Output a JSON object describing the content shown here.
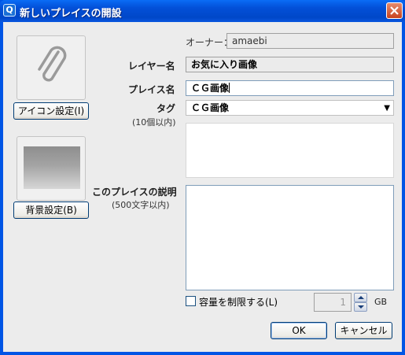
{
  "window": {
    "title": "新しいプレイスの開設",
    "app_icon_glyph": "Q"
  },
  "left": {
    "icon_button_label": "アイコン設定(I)",
    "icon_name": "paperclip-icon",
    "bg_button_label": "背景設定(B)"
  },
  "form": {
    "owner_label": "オーナー：",
    "owner_value": "amaebi",
    "layer_label": "レイヤー名",
    "layer_value": "お気に入り画像",
    "place_label": "プレイス名",
    "place_value": "ＣＧ画像",
    "tag_label": "タグ",
    "tag_sublabel": "(10個以内)",
    "tag_value": "ＣＧ画像",
    "desc_label": "このプレイスの説明",
    "desc_sublabel": "(500文字以内)",
    "limit_label": "容量を制限する(L)",
    "limit_checked": false,
    "capacity_value": "1",
    "capacity_unit": "GB"
  },
  "buttons": {
    "ok": "OK",
    "cancel": "キャンセル"
  },
  "colors": {
    "titlebar": "#0350d8",
    "client_bg": "#ececec",
    "close_button": "#c9431f"
  }
}
